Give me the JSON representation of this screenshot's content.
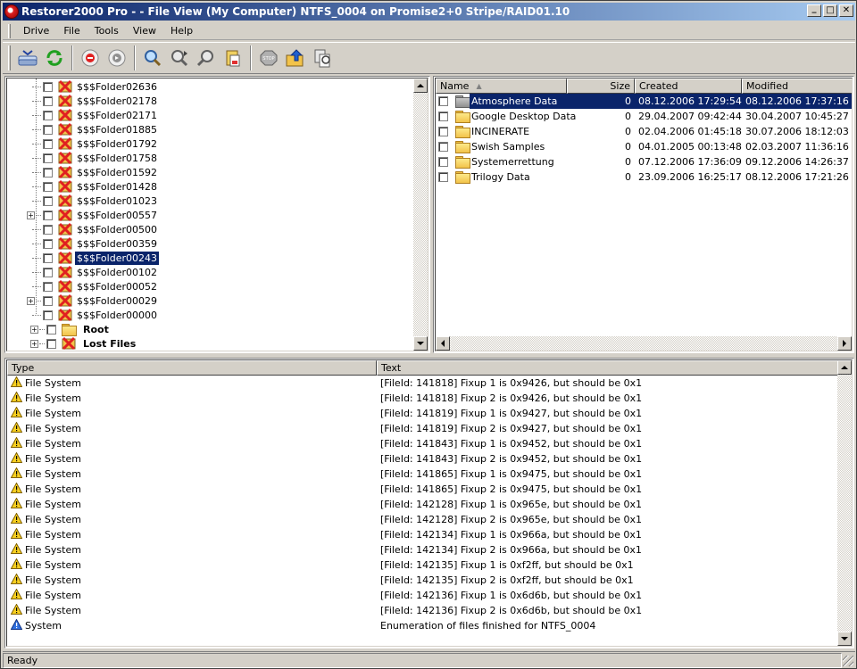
{
  "window": {
    "title": "Restorer2000 Pro -   - File View (My Computer) NTFS_0004 on Promise2+0 Stripe/RAID01.10",
    "minimize": "_",
    "maximize": "□",
    "close": "✕"
  },
  "menu": [
    "Drive",
    "File",
    "Tools",
    "View",
    "Help"
  ],
  "toolbar": [
    "drive-icon",
    "refresh-icon",
    "stop-red-icon",
    "recover-icon",
    "search-icon",
    "find-next-icon",
    "find-prev-icon",
    "clipboard-icon",
    "stop-sign-icon",
    "up-folder-icon",
    "mask-icon"
  ],
  "tree": {
    "items": [
      {
        "label": "$$$Folder02636",
        "expander": false,
        "icon": "deleted"
      },
      {
        "label": "$$$Folder02178",
        "expander": false,
        "icon": "deleted"
      },
      {
        "label": "$$$Folder02171",
        "expander": false,
        "icon": "deleted"
      },
      {
        "label": "$$$Folder01885",
        "expander": false,
        "icon": "deleted"
      },
      {
        "label": "$$$Folder01792",
        "expander": false,
        "icon": "deleted"
      },
      {
        "label": "$$$Folder01758",
        "expander": false,
        "icon": "deleted"
      },
      {
        "label": "$$$Folder01592",
        "expander": false,
        "icon": "deleted"
      },
      {
        "label": "$$$Folder01428",
        "expander": false,
        "icon": "deleted"
      },
      {
        "label": "$$$Folder01023",
        "expander": false,
        "icon": "deleted"
      },
      {
        "label": "$$$Folder00557",
        "expander": true,
        "icon": "deleted"
      },
      {
        "label": "$$$Folder00500",
        "expander": false,
        "icon": "deleted"
      },
      {
        "label": "$$$Folder00359",
        "expander": false,
        "icon": "deleted"
      },
      {
        "label": "$$$Folder00243",
        "expander": false,
        "icon": "deleted",
        "selected": true
      },
      {
        "label": "$$$Folder00102",
        "expander": false,
        "icon": "deleted"
      },
      {
        "label": "$$$Folder00052",
        "expander": false,
        "icon": "deleted"
      },
      {
        "label": "$$$Folder00029",
        "expander": true,
        "icon": "deleted"
      },
      {
        "label": "$$$Folder00000",
        "expander": false,
        "icon": "deleted"
      }
    ],
    "root_items": [
      {
        "label": "Root",
        "icon": "folder"
      },
      {
        "label": "Lost Files",
        "icon": "deleted"
      }
    ]
  },
  "files": {
    "columns": {
      "name": "Name",
      "size": "Size",
      "created": "Created",
      "modified": "Modified"
    },
    "rows": [
      {
        "name": "Atmosphere Data",
        "size": "0",
        "created": "08.12.2006 17:29:54",
        "modified": "08.12.2006 17:37:16",
        "selected": true
      },
      {
        "name": "Google Desktop Data",
        "size": "0",
        "created": "29.04.2007 09:42:44",
        "modified": "30.04.2007 10:45:27"
      },
      {
        "name": "INCINERATE",
        "size": "0",
        "created": "02.04.2006 01:45:18",
        "modified": "30.07.2006 18:12:03"
      },
      {
        "name": "Swish Samples",
        "size": "0",
        "created": "04.01.2005 00:13:48",
        "modified": "02.03.2007 11:36:16"
      },
      {
        "name": "Systemerrettung",
        "size": "0",
        "created": "07.12.2006 17:36:09",
        "modified": "09.12.2006 14:26:37"
      },
      {
        "name": "Trilogy Data",
        "size": "0",
        "created": "23.09.2006 16:25:17",
        "modified": "08.12.2006 17:21:26"
      }
    ]
  },
  "log": {
    "columns": {
      "type": "Type",
      "text": "Text"
    },
    "rows": [
      {
        "type": "File System",
        "text": "[FileId: 141818] Fixup 1 is 0x9426, but should be 0x1",
        "icon": "warning"
      },
      {
        "type": "File System",
        "text": "[FileId: 141818] Fixup 2 is 0x9426, but should be 0x1",
        "icon": "warning"
      },
      {
        "type": "File System",
        "text": "[FileId: 141819] Fixup 1 is 0x9427, but should be 0x1",
        "icon": "warning"
      },
      {
        "type": "File System",
        "text": "[FileId: 141819] Fixup 2 is 0x9427, but should be 0x1",
        "icon": "warning"
      },
      {
        "type": "File System",
        "text": "[FileId: 141843] Fixup 1 is 0x9452, but should be 0x1",
        "icon": "warning"
      },
      {
        "type": "File System",
        "text": "[FileId: 141843] Fixup 2 is 0x9452, but should be 0x1",
        "icon": "warning"
      },
      {
        "type": "File System",
        "text": "[FileId: 141865] Fixup 1 is 0x9475, but should be 0x1",
        "icon": "warning"
      },
      {
        "type": "File System",
        "text": "[FileId: 141865] Fixup 2 is 0x9475, but should be 0x1",
        "icon": "warning"
      },
      {
        "type": "File System",
        "text": "[FileId: 142128] Fixup 1 is 0x965e, but should be 0x1",
        "icon": "warning"
      },
      {
        "type": "File System",
        "text": "[FileId: 142128] Fixup 2 is 0x965e, but should be 0x1",
        "icon": "warning"
      },
      {
        "type": "File System",
        "text": "[FileId: 142134] Fixup 1 is 0x966a, but should be 0x1",
        "icon": "warning"
      },
      {
        "type": "File System",
        "text": "[FileId: 142134] Fixup 2 is 0x966a, but should be 0x1",
        "icon": "warning"
      },
      {
        "type": "File System",
        "text": "[FileId: 142135] Fixup 1 is 0xf2ff, but should be 0x1",
        "icon": "warning"
      },
      {
        "type": "File System",
        "text": "[FileId: 142135] Fixup 2 is 0xf2ff, but should be 0x1",
        "icon": "warning"
      },
      {
        "type": "File System",
        "text": "[FileId: 142136] Fixup 1 is 0x6d6b, but should be 0x1",
        "icon": "warning"
      },
      {
        "type": "File System",
        "text": "[FileId: 142136] Fixup 2 is 0x6d6b, but should be 0x1",
        "icon": "warning"
      },
      {
        "type": "System",
        "text": "Enumeration of files finished for NTFS_0004",
        "icon": "info"
      }
    ]
  },
  "status": {
    "text": "Ready"
  },
  "colors": {
    "selection": "#0a246a",
    "titlebar_start": "#0a246a",
    "titlebar_end": "#a6caf0",
    "face": "#d4d0c8"
  }
}
